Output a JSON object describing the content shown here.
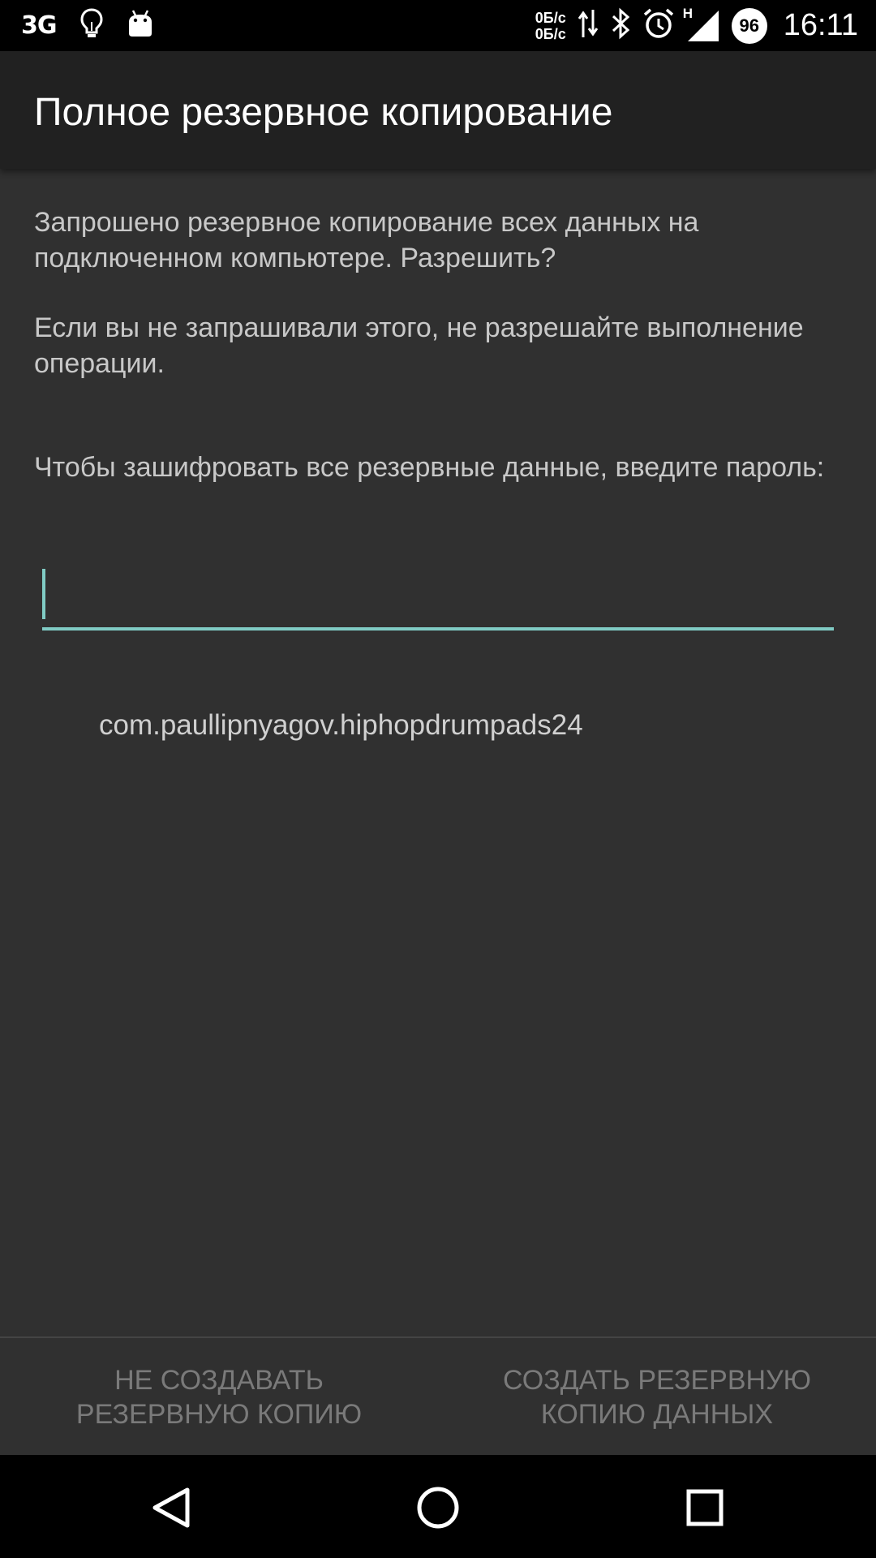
{
  "status_bar": {
    "network_type": "3G",
    "speed_up": "0Б/с",
    "speed_down": "0Б/с",
    "battery_level": "96",
    "time": "16:11",
    "signal_label": "H",
    "left_icons": [
      "lightbulb-icon",
      "android-icon"
    ],
    "right_icons": [
      "data-arrows-icon",
      "bluetooth-icon",
      "alarm-icon",
      "signal-icon"
    ]
  },
  "app_bar": {
    "title": "Полное резервное копирование"
  },
  "content": {
    "paragraph_1": "Запрошено резервное копирование всех данных на подключенном компьютере. Разрешить?",
    "paragraph_2": "Если вы не запрашивали этого, не разрешайте выполнение операции.",
    "paragraph_3": "Чтобы зашифровать все резервные данные, введите пароль:",
    "password_value": "",
    "package_name": "com.paullipnyagov.hiphopdrumpads24"
  },
  "buttons": {
    "deny": "НЕ СОЗДАВАТЬ\nРЕЗЕРВНУЮ КОПИЮ",
    "allow": "СОЗДАТЬ РЕЗЕРВНУЮ\nКОПИЮ ДАННЫХ"
  },
  "nav_bar": {
    "icons": [
      "back-icon",
      "home-icon",
      "recents-icon"
    ]
  },
  "colors": {
    "accent": "#80cbc4",
    "background": "#303030",
    "app_bar": "#212121",
    "disabled_text": "#7a7a7a"
  }
}
